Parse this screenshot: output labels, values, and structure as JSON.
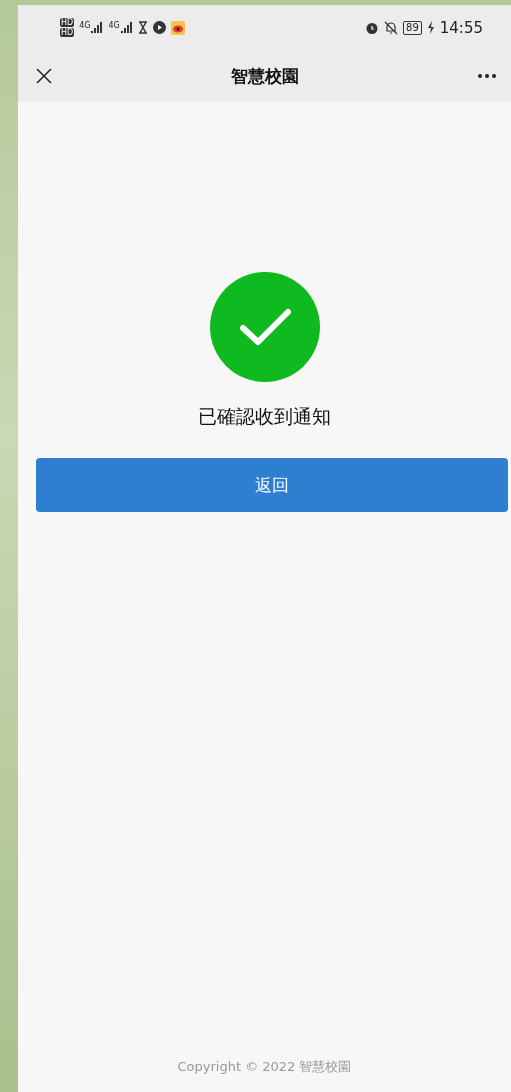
{
  "status_bar": {
    "sim_badges": [
      "HD",
      "HD"
    ],
    "networks": [
      "4G",
      "4G"
    ],
    "battery": "89",
    "time": "14:55"
  },
  "nav_bar": {
    "title": "智慧校園"
  },
  "result": {
    "message": "已確認收到通知"
  },
  "buttons": [
    {
      "label": "返回"
    }
  ],
  "footer": {
    "copyright": "Copyright © 2022 智慧校園"
  }
}
